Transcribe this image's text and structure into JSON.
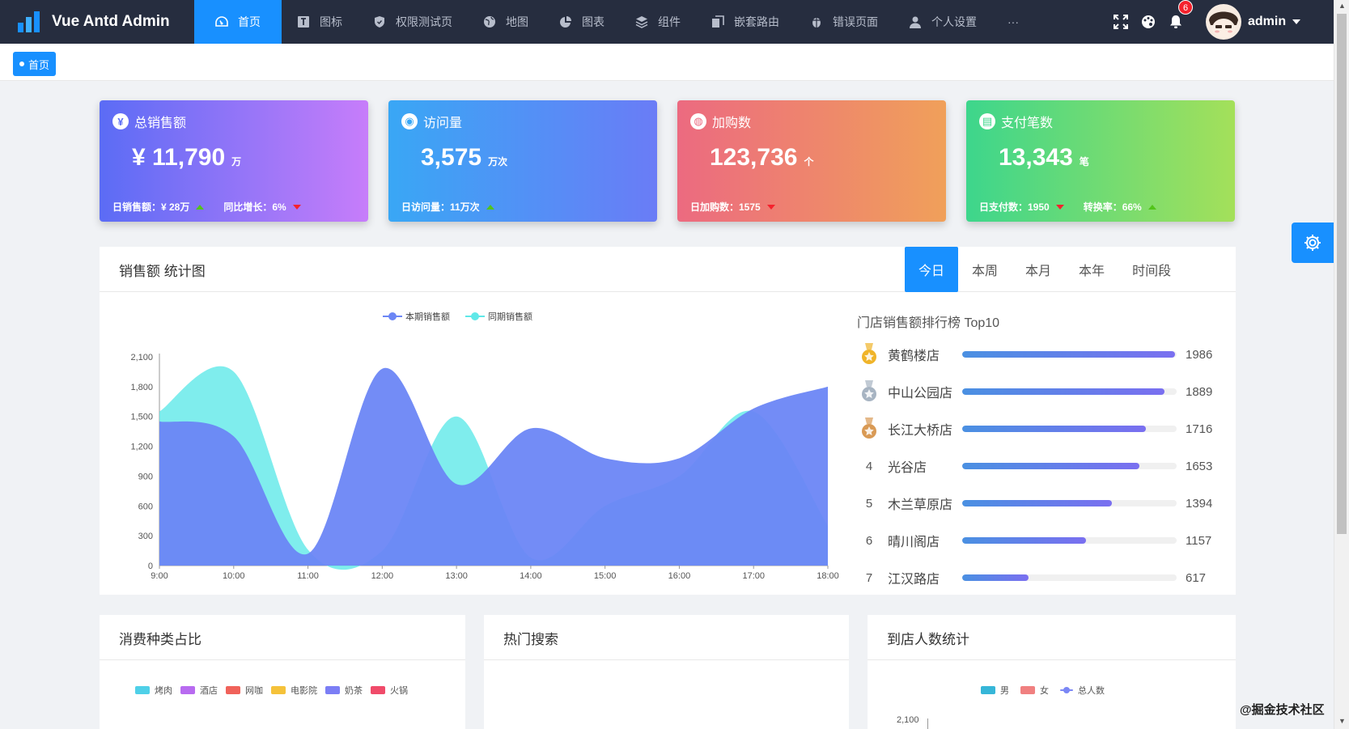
{
  "app": {
    "title": "Vue Antd Admin"
  },
  "nav": [
    {
      "label": "首页",
      "icon": "dashboard-icon",
      "active": true
    },
    {
      "label": "图标",
      "icon": "font-icon"
    },
    {
      "label": "权限测试页",
      "icon": "safety-icon"
    },
    {
      "label": "地图",
      "icon": "globe-icon"
    },
    {
      "label": "图表",
      "icon": "pie-chart-icon"
    },
    {
      "label": "组件",
      "icon": "layers-icon"
    },
    {
      "label": "嵌套路由",
      "icon": "copy-icon"
    },
    {
      "label": "错误页面",
      "icon": "bug-icon"
    },
    {
      "label": "个人设置",
      "icon": "user-icon"
    },
    {
      "label": "···",
      "icon": "more-icon"
    }
  ],
  "header": {
    "notification_count": "6",
    "username": "admin"
  },
  "tags": [
    {
      "label": "首页",
      "active": true
    }
  ],
  "stat_cards": [
    {
      "title": "总销售额",
      "icon": "money-icon",
      "value": "¥ 11,790",
      "unit": "万",
      "foot": [
        {
          "text": "日销售额：¥ 28万",
          "trend": "up"
        },
        {
          "text": "同比增长：6%",
          "trend": "down"
        }
      ],
      "gradient": [
        "#5b6cf5",
        "#c77dfa"
      ]
    },
    {
      "title": "访问量",
      "icon": "eye-icon",
      "value": "3,575",
      "unit": "万次",
      "foot": [
        {
          "text": "日访问量：11万次",
          "trend": "up"
        }
      ],
      "gradient": [
        "#39a7f5",
        "#6a7cf6"
      ]
    },
    {
      "title": "加购数",
      "icon": "cart-icon",
      "value": "123,736",
      "unit": "个",
      "foot": [
        {
          "text": "日加购数：1575",
          "trend": "down"
        }
      ],
      "gradient": [
        "#ec6a80",
        "#f0a05a"
      ]
    },
    {
      "title": "支付笔数",
      "icon": "wallet-icon",
      "value": "13,343",
      "unit": "笔",
      "foot": [
        {
          "text": "日支付数：1950",
          "trend": "down"
        },
        {
          "text": "转换率：66%",
          "trend": "up"
        }
      ],
      "gradient": [
        "#3dd68c",
        "#a4e05a"
      ]
    }
  ],
  "sales_panel": {
    "title": "销售额 统计图",
    "range_tabs": [
      {
        "label": "今日",
        "active": true
      },
      {
        "label": "本周"
      },
      {
        "label": "本月"
      },
      {
        "label": "本年"
      },
      {
        "label": "时间段"
      }
    ]
  },
  "chart_data": {
    "type": "area",
    "title": "",
    "x": [
      "9:00",
      "10:00",
      "11:00",
      "12:00",
      "13:00",
      "14:00",
      "15:00",
      "16:00",
      "17:00",
      "18:00"
    ],
    "ylim": [
      0,
      2100
    ],
    "yticks": [
      "0",
      "300",
      "600",
      "900",
      "1,200",
      "1,500",
      "1,800",
      "2,100"
    ],
    "series": [
      {
        "name": "本期销售额",
        "color": "#6c86f5",
        "values": [
          1450,
          1300,
          120,
          1980,
          820,
          1380,
          1080,
          1080,
          1580,
          1800
        ]
      },
      {
        "name": "同期销售额",
        "color": "#5fe8e8",
        "values": [
          1550,
          1950,
          160,
          150,
          1500,
          80,
          600,
          900,
          1550,
          400
        ]
      }
    ],
    "legend": "top"
  },
  "ranking": {
    "title": "门店销售额排行榜 Top10",
    "max": 2000,
    "items": [
      {
        "rank": "",
        "name": "黄鹤楼店",
        "value": 1986,
        "medal": "gold"
      },
      {
        "rank": "",
        "name": "中山公园店",
        "value": 1889,
        "medal": "silver"
      },
      {
        "rank": "",
        "name": "长江大桥店",
        "value": 1716,
        "medal": "bronze"
      },
      {
        "rank": "4",
        "name": "光谷店",
        "value": 1653
      },
      {
        "rank": "5",
        "name": "木兰草原店",
        "value": 1394
      },
      {
        "rank": "6",
        "name": "晴川阁店",
        "value": 1157
      },
      {
        "rank": "7",
        "name": "江汉路店",
        "value": 617
      }
    ]
  },
  "bottom_panels": [
    {
      "title": "消费种类占比",
      "legend": [
        {
          "label": "烤肉",
          "color": "#4fd0e8"
        },
        {
          "label": "酒店",
          "color": "#b86bf0"
        },
        {
          "label": "网咖",
          "color": "#f0625a"
        },
        {
          "label": "电影院",
          "color": "#f5c23a"
        },
        {
          "label": "奶茶",
          "color": "#7b7ef5"
        },
        {
          "label": "火锅",
          "color": "#f04b6a"
        }
      ]
    },
    {
      "title": "热门搜索"
    },
    {
      "title": "到店人数统计",
      "legend": [
        {
          "label": "男",
          "color": "#36b6d8"
        },
        {
          "label": "女",
          "color": "#f08080"
        },
        {
          "label": "总人数",
          "color": "#7b87f5"
        }
      ],
      "first_tick": "2,100"
    }
  ],
  "watermark": "@掘金技术社区"
}
